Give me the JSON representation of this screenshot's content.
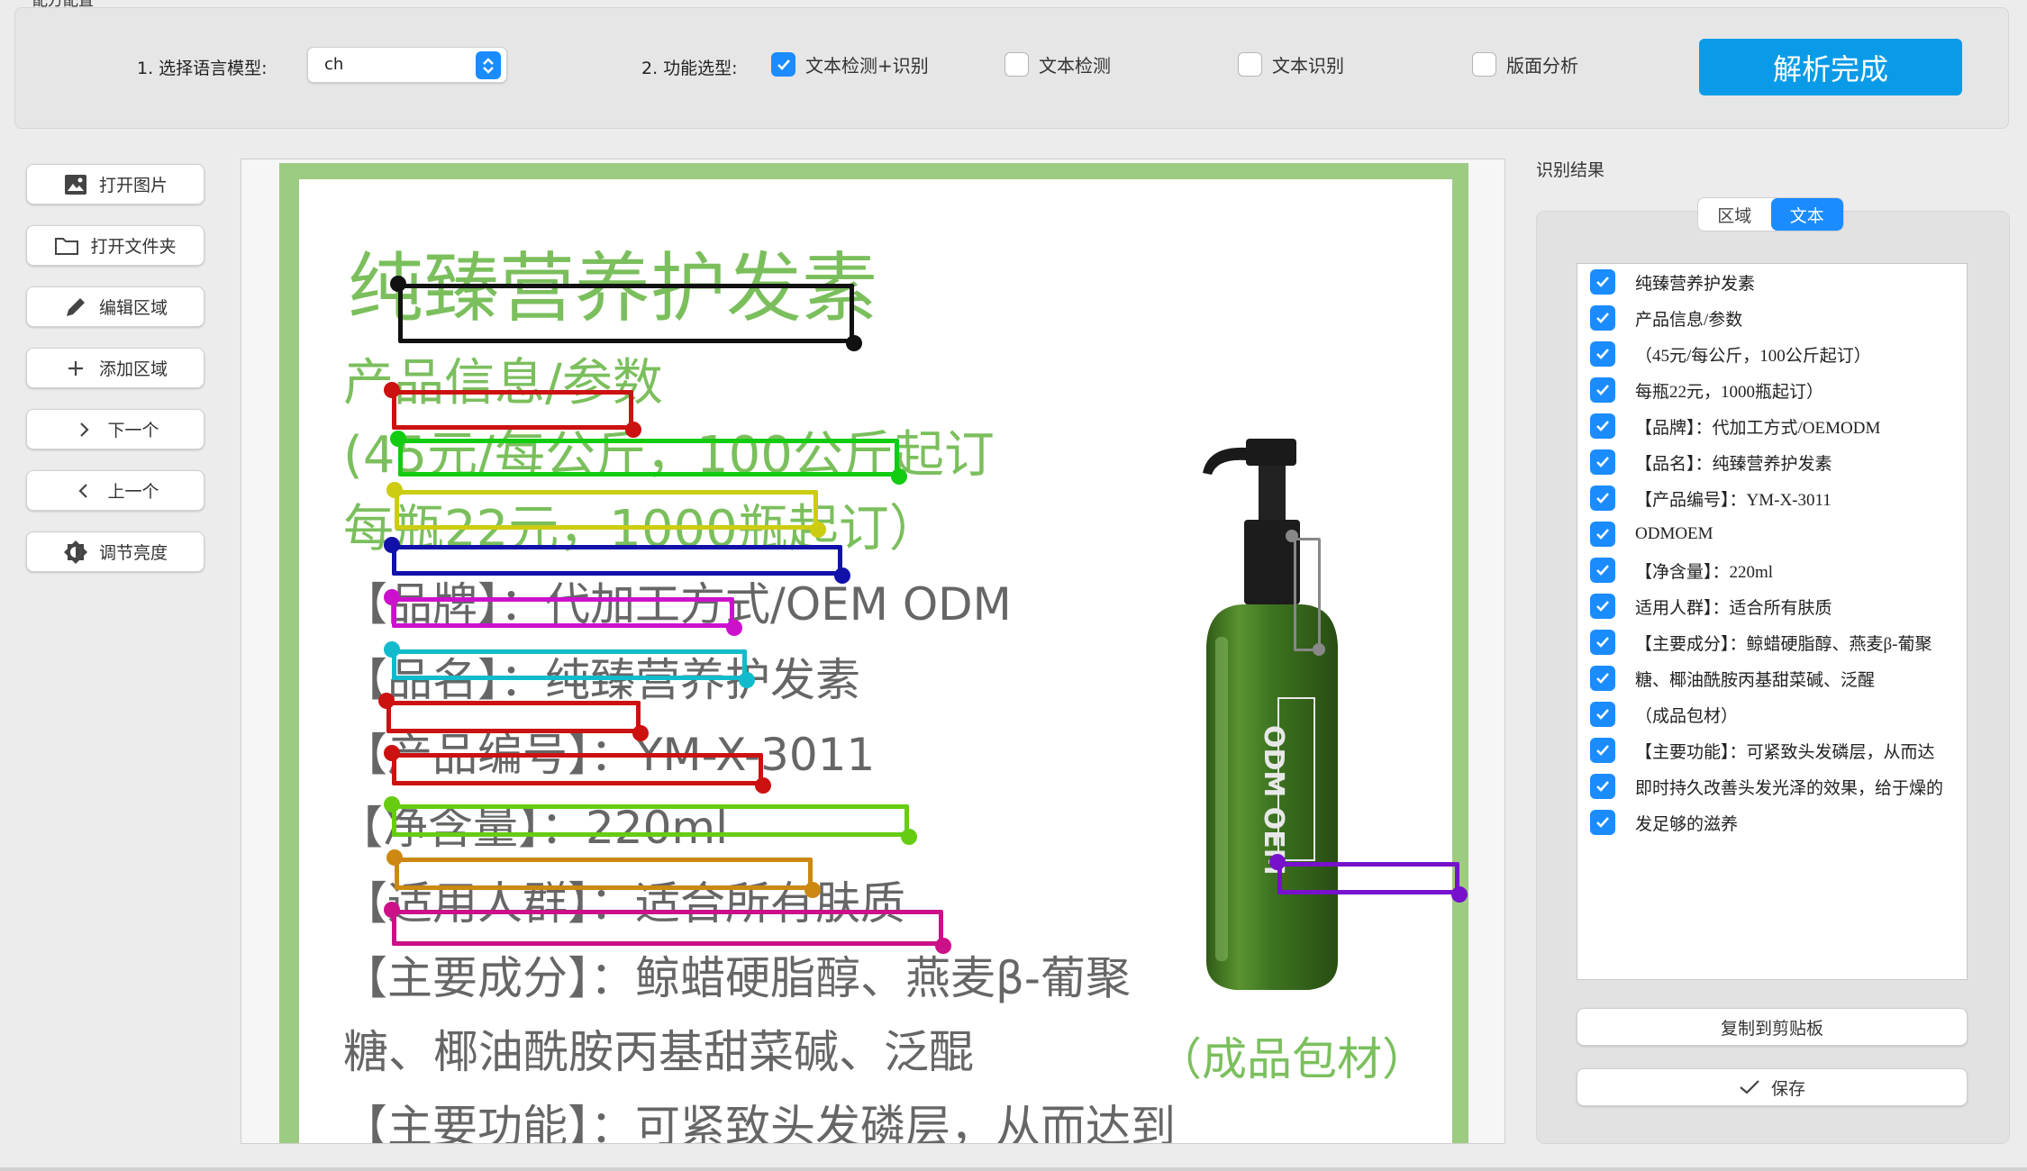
{
  "toolbar": {
    "group_title": "配方配置",
    "model_label": "1. 选择语言模型:",
    "model_value": "ch",
    "function_label": "2. 功能选型:",
    "options": [
      {
        "label": "文本检测+识别",
        "checked": true
      },
      {
        "label": "文本检测",
        "checked": false
      },
      {
        "label": "文本识别",
        "checked": false
      },
      {
        "label": "版面分析",
        "checked": false
      }
    ],
    "parse_button": "解析完成"
  },
  "sidebar": {
    "buttons": [
      {
        "label": "打开图片",
        "icon": "image-icon"
      },
      {
        "label": "打开文件夹",
        "icon": "folder-icon"
      },
      {
        "label": "编辑区域",
        "icon": "pencil-icon"
      },
      {
        "label": "添加区域",
        "icon": "plus-icon"
      },
      {
        "label": "下一个",
        "icon": "chevron-right-icon"
      },
      {
        "label": "上一个",
        "icon": "chevron-left-icon"
      },
      {
        "label": "调节亮度",
        "icon": "brightness-icon"
      }
    ]
  },
  "document": {
    "lines": [
      "纯臻营养护发素",
      "产品信息/参数",
      "(45元/每公斤，100公斤起订",
      "每瓶22元，1000瓶起订）",
      "【品牌】：代加工方式/OEM ODM",
      "【品名】：纯臻营养护发素",
      "【产品编号】：YM-X-3011",
      "【净含量】：220ml",
      "【适用人群】：适合所有肤质",
      "【主要成分】：鲸蜡硬脂醇、燕麦β-葡聚",
      "糖、椰油酰胺丙基甜菜碱、泛醌",
      "【主要功能】：可紧致头发磷层，从而达到",
      "（成品包材）"
    ],
    "bottle_text": "ODM OEM",
    "box_colors": [
      "#111111",
      "#cc1111",
      "#11cc11",
      "#cccc11",
      "#1111aa",
      "#cc11cc",
      "#11bbcc",
      "#cc1111",
      "#cc1111",
      "#66cc11",
      "#cc8811",
      "#cc1188",
      "#7711cc",
      "#888888"
    ]
  },
  "results": {
    "title": "识别结果",
    "tabs": [
      {
        "label": "区域",
        "active": false
      },
      {
        "label": "文本",
        "active": true
      }
    ],
    "items": [
      "纯臻营养护发素",
      "产品信息/参数",
      "（45元/每公斤，100公斤起订）",
      "每瓶22元，1000瓶起订）",
      "【品牌】：代加工方式/OEMODM",
      "【品名】：纯臻营养护发素",
      "【产品编号】：YM-X-3011",
      "ODMOEM",
      "【净含量】：220ml",
      "适用人群】：适合所有肤质",
      "【主要成分】：鲸蜡硬脂醇、燕麦β-葡聚",
      "糖、椰油酰胺丙基甜菜碱、泛醒",
      "（成品包材）",
      "【主要功能】：可紧致头发磷层，从而达",
      "即时持久改善头发光泽的效果，给于燥的",
      "发足够的滋养"
    ],
    "copy_button": "复制到剪贴板",
    "save_button": "保存"
  }
}
